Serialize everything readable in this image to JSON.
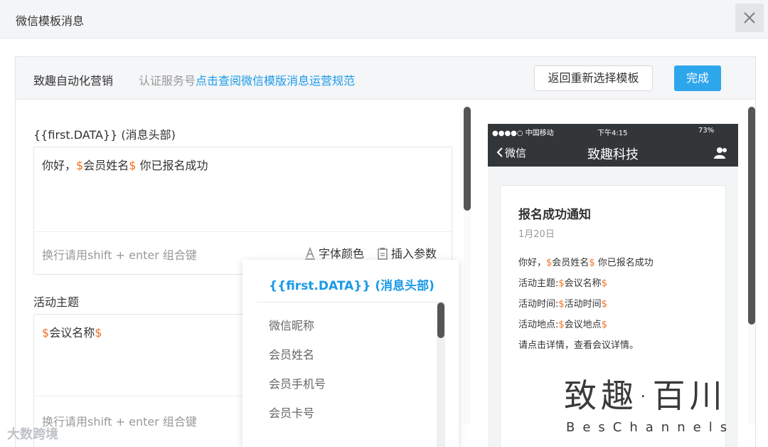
{
  "dialog": {
    "title": "微信模板消息"
  },
  "topbar": {
    "brand": "致趣自动化营销",
    "cert_prefix": "认证服务号",
    "cert_link": "点击查阅微信模版消息运营规范",
    "back_label": "返回重新选择模板",
    "done_label": "完成"
  },
  "field1": {
    "label": "{{first.DATA}} (消息头部)",
    "prefix": "你好，",
    "var_dollar_open": "$",
    "var_name": "会员姓名",
    "var_dollar_close": "$",
    "suffix": " 你已报名成功",
    "hint": "换行请用shift + enter 组合键",
    "font_color": "字体颜色",
    "insert_param": "插入参数"
  },
  "field2": {
    "label": "活动主题",
    "var_dollar_open": "$",
    "var_name": "会议名称",
    "var_dollar_close": "$",
    "hint": "换行请用shift + enter 组合键"
  },
  "dropdown": {
    "header": "{{first.DATA}} (消息头部)",
    "items": [
      "微信昵称",
      "会员姓名",
      "会员手机号",
      "会员卡号"
    ]
  },
  "phone": {
    "carrier": "●●●●○ 中国移动",
    "time": "下午4:15",
    "battery": "73%",
    "back": "微信",
    "title": "致趣科技",
    "card": {
      "title": "报名成功通知",
      "date": "1月20日",
      "lines": [
        {
          "prefix": "你好，",
          "var": "会员姓名",
          "suffix": " 你已报名成功"
        },
        {
          "prefix": "活动主题:",
          "var": "会议名称",
          "suffix": ""
        },
        {
          "prefix": "活动时间:",
          "var": "活动时间",
          "suffix": ""
        },
        {
          "prefix": "活动地点:",
          "var": "会议地点",
          "suffix": ""
        }
      ],
      "footer": "请点击详情，查看会议详情。"
    }
  },
  "watermark": {
    "cn": "致趣·百川",
    "en": "BesChannels",
    "left": "大数跨境"
  }
}
